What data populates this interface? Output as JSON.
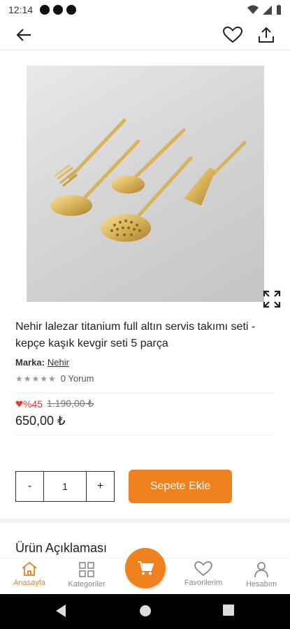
{
  "status_bar": {
    "time": "12:14"
  },
  "header": {
    "back_icon": "arrow-left-icon",
    "favorite_icon": "heart-icon",
    "share_icon": "share-icon"
  },
  "product": {
    "title": "Nehir lalezar titanium full altın servis takımı seti - kepçe kaşık kevgir seti 5 parça",
    "brand_label": "Marka:",
    "brand_name": "Nehir",
    "review_count": "0 Yorum",
    "rating_stars": 0,
    "discount_percent": "%45",
    "old_price": "1.190,00 ₺",
    "price": "650,00 ₺",
    "quantity": "1",
    "qty_minus": "-",
    "qty_plus": "+",
    "add_to_cart": "Sepete Ekle",
    "description_title": "Ürün Açıklaması"
  },
  "bottom_nav": {
    "items": [
      {
        "label": "Anasayfa",
        "icon": "home-icon",
        "active": true
      },
      {
        "label": "Kategoriler",
        "icon": "grid-icon",
        "active": false
      },
      {
        "label": "",
        "icon": "cart-icon",
        "active": false
      },
      {
        "label": "Favorilerim",
        "icon": "heart-icon",
        "active": false
      },
      {
        "label": "Hesabım",
        "icon": "user-icon",
        "active": false
      }
    ]
  },
  "colors": {
    "accent": "#f0811f",
    "discount": "#e53935"
  }
}
